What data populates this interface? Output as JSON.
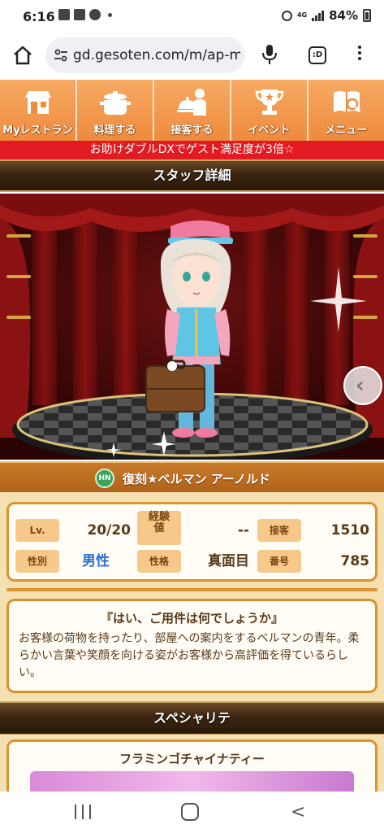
{
  "status_bar": {
    "time": "6:16",
    "network": "4G",
    "battery": "84%"
  },
  "browser": {
    "url": "gd.gesoten.com/m/ap-m",
    "tabs_label": ":D"
  },
  "game_nav": {
    "items": [
      {
        "label": "Myレストラン",
        "icon": "restaurant-icon"
      },
      {
        "label": "料理する",
        "icon": "cooking-pot-icon"
      },
      {
        "label": "接客する",
        "icon": "serving-waiter-icon"
      },
      {
        "label": "イベント",
        "icon": "trophy-icon"
      },
      {
        "label": "メニュー",
        "icon": "menu-book-icon"
      }
    ]
  },
  "promo_banner": "お助けダブルDXでゲスト満足度が3倍☆",
  "staff_section_title": "スタッフ詳細",
  "staff": {
    "badge": "HN",
    "name": "復刻★ベルマン アーノルド",
    "stats": {
      "level_label": "Lv.",
      "level": "20/20",
      "exp_label": "経験値",
      "exp": "--",
      "service_label": "接客",
      "service": "1510",
      "gender_label": "性別",
      "gender": "男性",
      "personality_label": "性格",
      "personality": "真面目",
      "number_label": "番号",
      "number": "785"
    },
    "quote": "『はい、ご用件は何でしょうか』",
    "description": "お客様の荷物を持ったり、部屋への案内をするベルマンの青年。柔らかい言葉や笑顔を向ける姿がお客様から高評価を得ているらしい。"
  },
  "specialty_section_title": "スペシャリテ",
  "specialty": {
    "name": "フラミンゴチャイナティー"
  },
  "colors": {
    "nav_orange": "#ee8b3e",
    "promo_red": "#e21b23",
    "panel_border": "#d8952f",
    "gender_blue": "#2a6fd1"
  }
}
